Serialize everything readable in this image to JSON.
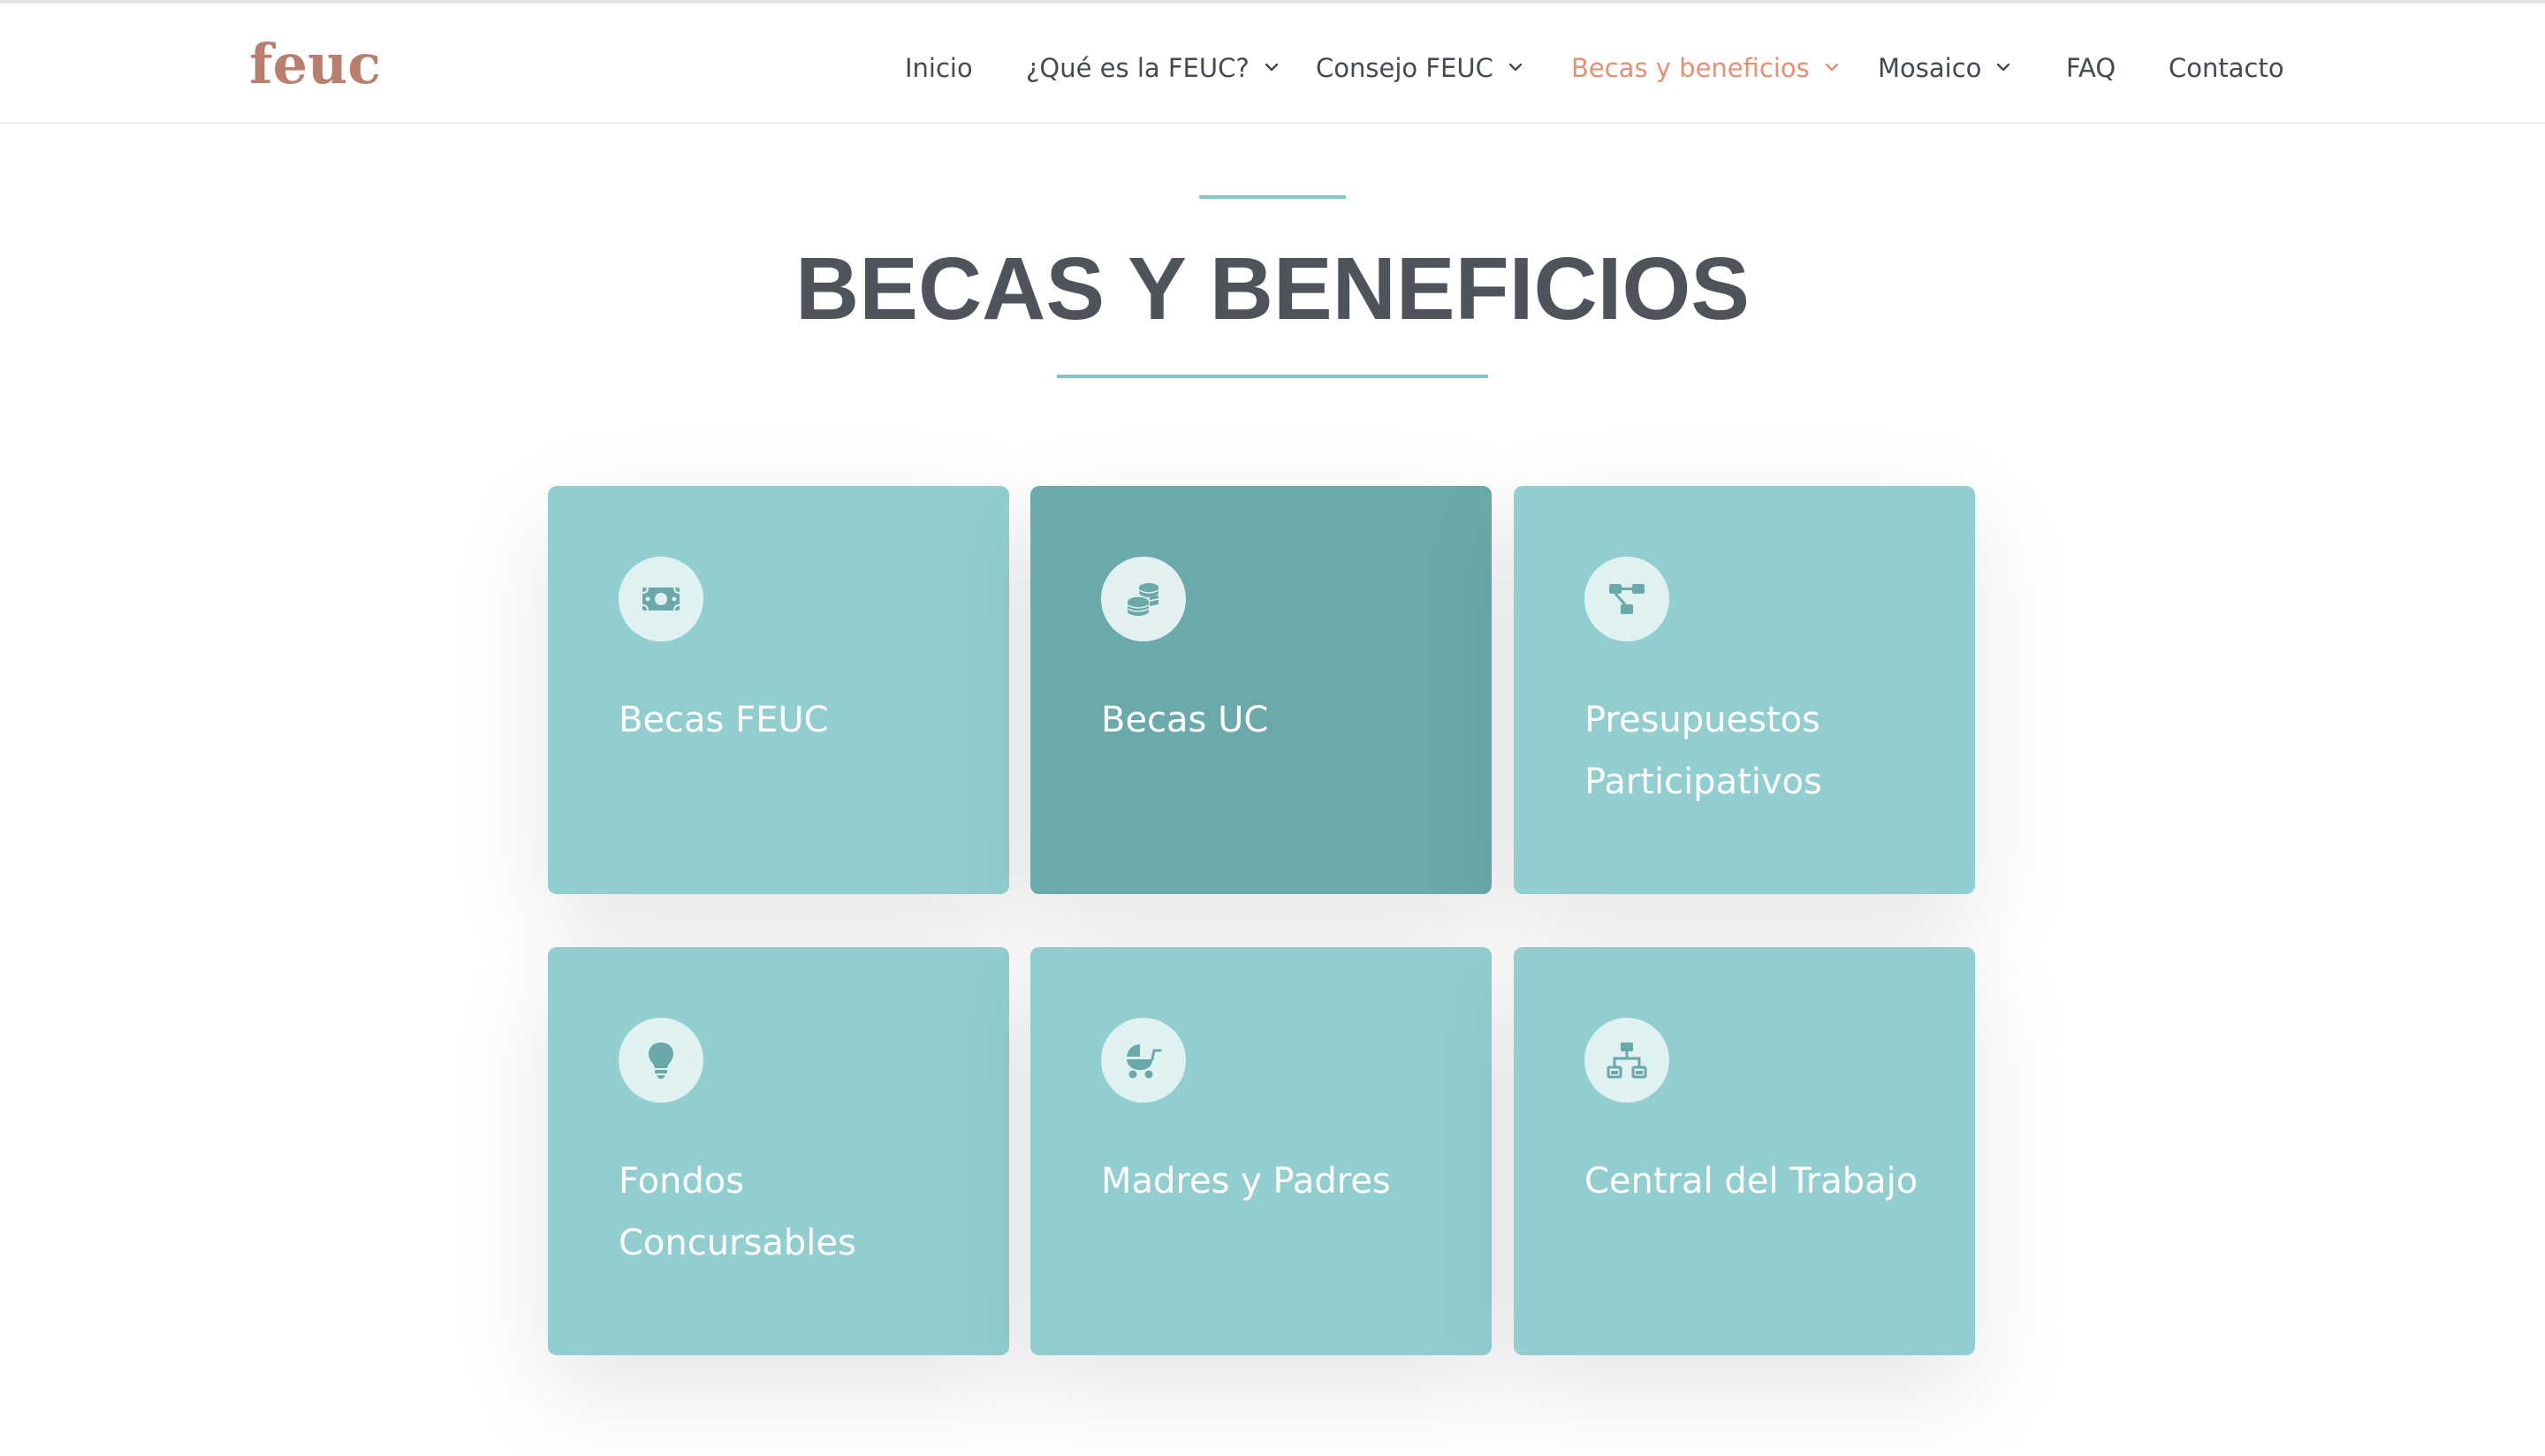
{
  "header": {
    "logo_text": "feuc",
    "nav": [
      {
        "label": "Inicio",
        "dropdown": false,
        "active": false
      },
      {
        "label": "¿Qué es la FEUC?",
        "dropdown": true,
        "active": false
      },
      {
        "label": "Consejo FEUC",
        "dropdown": true,
        "active": false
      },
      {
        "label": "Becas y beneficios",
        "dropdown": true,
        "active": true
      },
      {
        "label": "Mosaico",
        "dropdown": true,
        "active": false
      },
      {
        "label": "FAQ",
        "dropdown": false,
        "active": false
      },
      {
        "label": "Contacto",
        "dropdown": false,
        "active": false
      }
    ]
  },
  "main": {
    "title": "BECAS Y BENEFICIOS",
    "cards": [
      {
        "label": "Becas FEUC",
        "icon": "money-bill-icon",
        "active": false
      },
      {
        "label": "Becas UC",
        "icon": "coins-icon",
        "active": true
      },
      {
        "label": "Presupuestos Participativos",
        "icon": "project-diagram-icon",
        "active": false
      },
      {
        "label": "Fondos Concursables",
        "icon": "lightbulb-icon",
        "active": false
      },
      {
        "label": "Madres y Padres",
        "icon": "baby-carriage-icon",
        "active": false
      },
      {
        "label": "Central del Trabajo",
        "icon": "sitemap-icon",
        "active": false
      }
    ]
  },
  "colors": {
    "logo": "#b87f6f",
    "nav_text": "#454950",
    "nav_active": "#e58f73",
    "title": "#4f545c",
    "accent_line": "#7fc7c9",
    "card": "#92ced0",
    "card_active": "#6ba9ab",
    "icon_circle": "#dff1f1",
    "icon_fill": "#6aa8aa"
  }
}
